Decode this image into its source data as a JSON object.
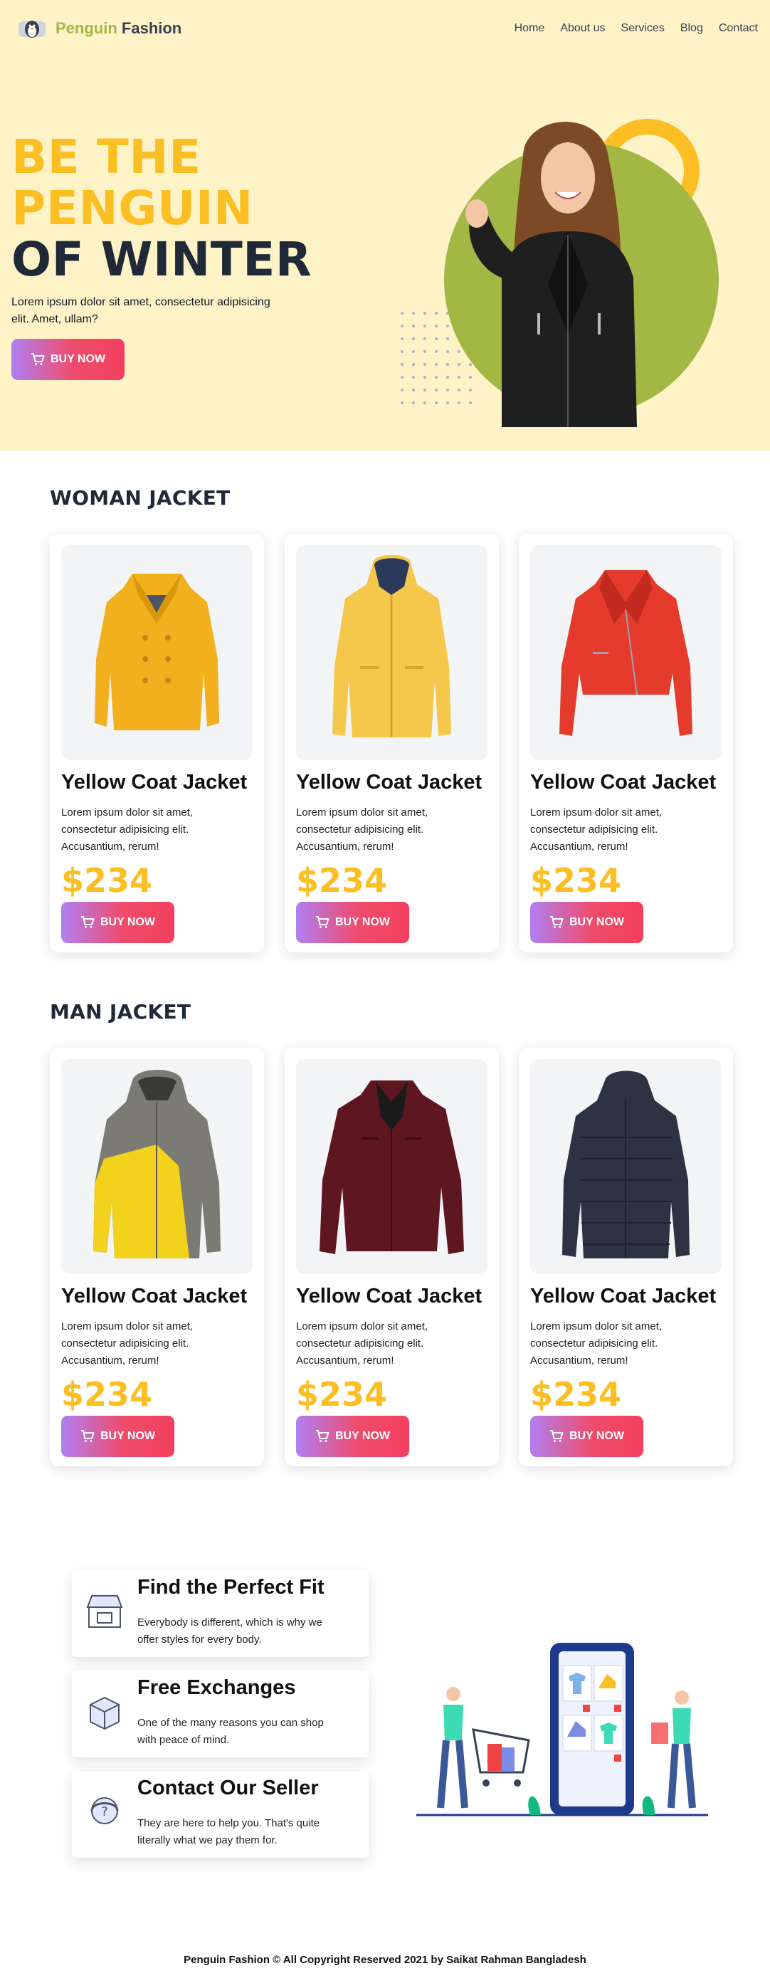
{
  "navbar": {
    "brand_part1": "Penguin",
    "brand_part2": "Fashion",
    "links": [
      "Home",
      "About us",
      "Services",
      "Blog",
      "Contact"
    ]
  },
  "hero": {
    "title_line1": "BE THE",
    "title_line2": "PENGUIN",
    "title_line3": "OF WINTER",
    "subtitle": "Lorem ipsum dolor sit amet, consectetur adipisicing elit. Amet, ullam?",
    "button_label": "BUY NOW"
  },
  "woman_section": {
    "title": "WOMAN JACKET",
    "products": [
      {
        "name": "Yellow Coat Jacket",
        "description": "Lorem ipsum dolor sit amet, consectetur adipisicing elit. Accusantium, rerum!",
        "price": "$234",
        "button_label": "BUY NOW"
      },
      {
        "name": "Yellow Coat Jacket",
        "description": "Lorem ipsum dolor sit amet, consectetur adipisicing elit. Accusantium, rerum!",
        "price": "$234",
        "button_label": "BUY NOW"
      },
      {
        "name": "Yellow Coat Jacket",
        "description": "Lorem ipsum dolor sit amet, consectetur adipisicing elit. Accusantium, rerum!",
        "price": "$234",
        "button_label": "BUY NOW"
      }
    ]
  },
  "man_section": {
    "title": "MAN JACKET",
    "products": [
      {
        "name": "Yellow Coat Jacket",
        "description": "Lorem ipsum dolor sit amet, consectetur adipisicing elit. Accusantium, rerum!",
        "price": "$234",
        "button_label": "BUY NOW"
      },
      {
        "name": "Yellow Coat Jacket",
        "description": "Lorem ipsum dolor sit amet, consectetur adipisicing elit. Accusantium, rerum!",
        "price": "$234",
        "button_label": "BUY NOW"
      },
      {
        "name": "Yellow Coat Jacket",
        "description": "Lorem ipsum dolor sit amet, consectetur adipisicing elit. Accusantium, rerum!",
        "price": "$234",
        "button_label": "BUY NOW"
      }
    ]
  },
  "features": [
    {
      "title": "Find the Perfect Fit",
      "description": "Everybody is different, which is why we offer styles for every body.",
      "icon": "shop-icon"
    },
    {
      "title": "Free Exchanges",
      "description": "One of the many reasons you can shop with peace of mind.",
      "icon": "box-icon"
    },
    {
      "title": "Contact Our Seller",
      "description": "They are here to help you. That's quite literally what we pay them for.",
      "icon": "support-icon"
    }
  ],
  "footer": {
    "text": "Penguin Fashion © All Copyright Reserved 2021 by Saikat Rahman Bangladesh"
  },
  "colors": {
    "hero_bg": "#fef3c7",
    "accent_yellow": "#fbbf24",
    "brand_green": "#a3b745",
    "button_gradient_start": "#b07ff3",
    "button_gradient_end": "#f43f5e",
    "dark_text": "#1f2937"
  }
}
